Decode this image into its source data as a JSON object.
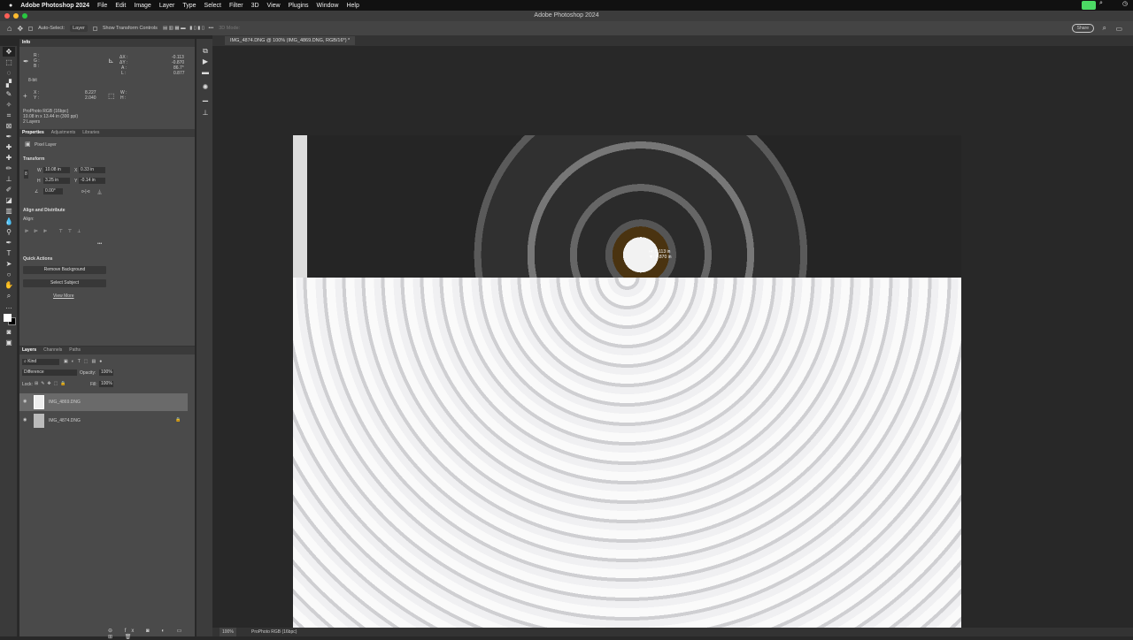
{
  "menubar": {
    "app": "Adobe Photoshop 2024",
    "items": [
      "File",
      "Edit",
      "Image",
      "Layer",
      "Type",
      "Select",
      "Filter",
      "3D",
      "View",
      "Plugins",
      "Window",
      "Help"
    ]
  },
  "window_title": "Adobe Photoshop 2024",
  "options": {
    "auto_select": "Auto-Select:",
    "auto_select_target": "Layer",
    "show_transform": "Show Transform Controls",
    "mode_3d": "3D Mode:",
    "share": "Share"
  },
  "document_tab": "IMG_4874.DNG @ 100% (IMG_4869.DNG, RGB/16*) *",
  "info": {
    "title": "Info",
    "r": "R :",
    "g": "G :",
    "b": "B :",
    "bit": "8-bit",
    "dx_label": "ΔX :",
    "dx": "-0.113",
    "dy_label": "ΔY :",
    "dy": "-0.870",
    "a_label": "A :",
    "a": "86.7°",
    "l_label": "L :",
    "l": "0.877",
    "x_label": "X :",
    "x": "8.227",
    "y_label": "Y :",
    "y": "2.040",
    "w_label": "W :",
    "h_label": "H :",
    "profile": "ProPhoto RGB (16bpc)",
    "size": "10.08 in x 13.44 in (300 ppi)",
    "layers": "2 Layers"
  },
  "properties": {
    "tabs": [
      "Properties",
      "Adjustments",
      "Libraries"
    ],
    "kind": "Pixel Layer",
    "transform": "Transform",
    "w_label": "W",
    "w": "10.08 in",
    "x_label": "X",
    "x": "0.33 in",
    "h_label": "H",
    "h": "3.25 in",
    "y_label": "Y",
    "y": "-0.14 in",
    "angle": "0.00°",
    "align_title": "Align and Distribute",
    "align_label": "Align:",
    "more": "•••",
    "quick_actions": "Quick Actions",
    "remove_bg": "Remove Background",
    "select_subject": "Select Subject",
    "view_more": "View More"
  },
  "layers": {
    "tabs": [
      "Layers",
      "Channels",
      "Paths"
    ],
    "filter": "Kind",
    "blend": "Difference",
    "opacity_label": "Opacity:",
    "opacity": "100%",
    "lock_label": "Lock:",
    "fill_label": "Fill:",
    "fill": "100%",
    "items": [
      {
        "name": "IMG_4869.DNG",
        "selected": true,
        "locked": false
      },
      {
        "name": "IMG_4874.DNG",
        "selected": false,
        "locked": true
      }
    ]
  },
  "canvas_readout": {
    "dx": "↦: 0.113 in",
    "dy": "▼: 0.870 in"
  },
  "status": {
    "zoom": "100%",
    "profile": "ProPhoto RGB (16bpc)"
  }
}
